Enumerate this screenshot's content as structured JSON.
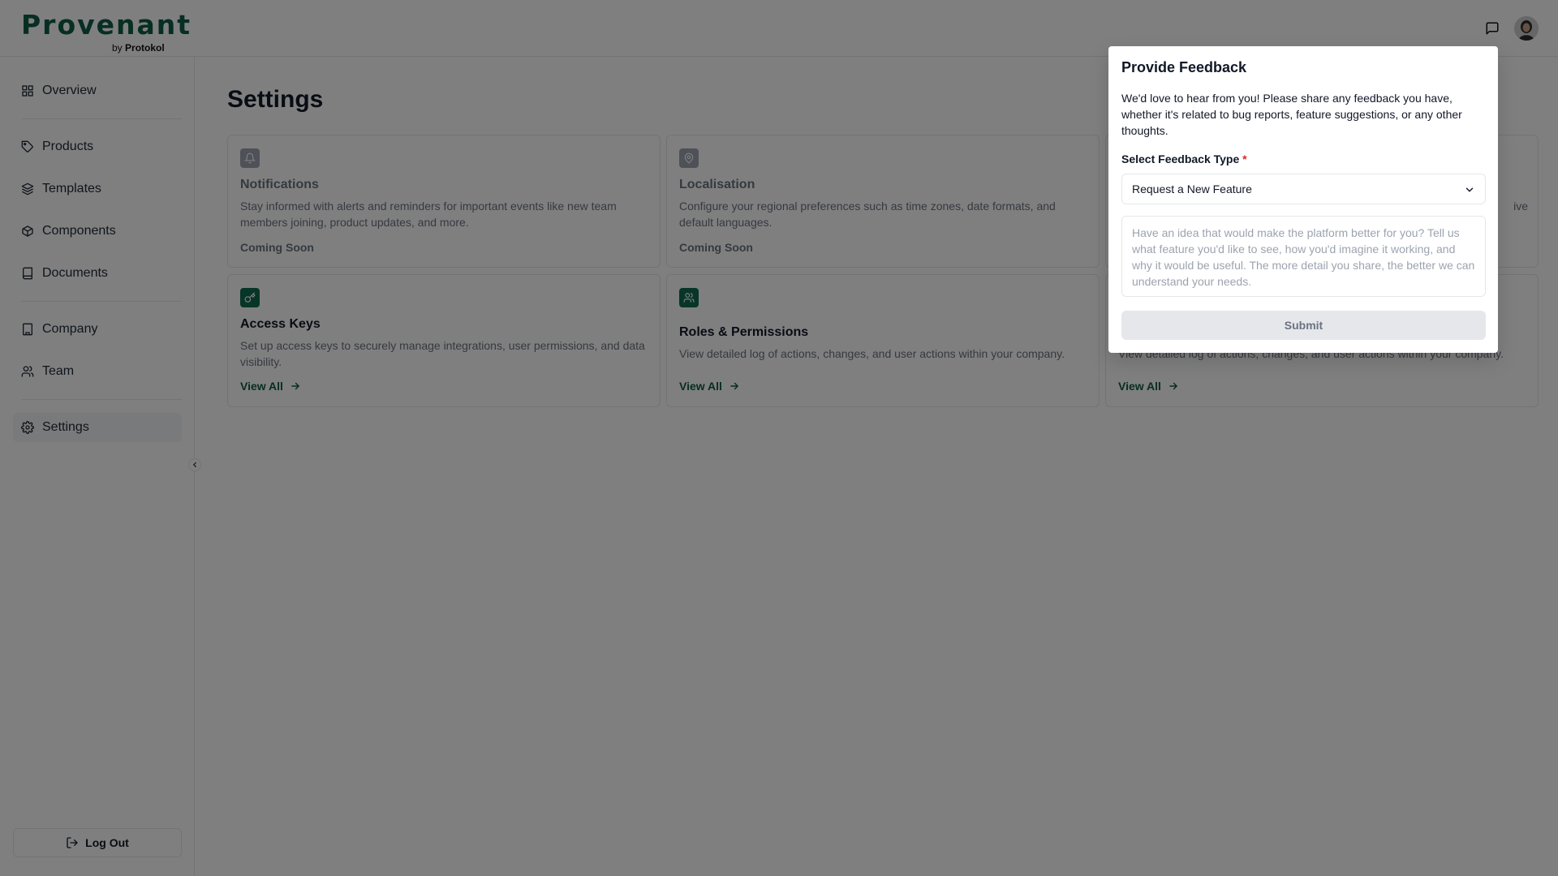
{
  "brand": {
    "name": "Provenant",
    "by": "by",
    "company": "Protokol"
  },
  "header": {
    "chat_icon": "message-square-icon",
    "avatar": "user-avatar"
  },
  "sidebar": {
    "items": [
      {
        "label": "Overview",
        "icon": "grid-icon"
      },
      {
        "label": "Products",
        "icon": "tag-icon"
      },
      {
        "label": "Templates",
        "icon": "layers-icon"
      },
      {
        "label": "Components",
        "icon": "box-icon"
      },
      {
        "label": "Documents",
        "icon": "book-icon"
      },
      {
        "label": "Company",
        "icon": "building-icon"
      },
      {
        "label": "Team",
        "icon": "users-icon"
      },
      {
        "label": "Settings",
        "icon": "gear-icon",
        "active": true
      }
    ],
    "logout_label": "Log Out"
  },
  "main": {
    "title": "Settings",
    "cards": [
      {
        "title": "Notifications",
        "description": "Stay informed with alerts and reminders for important events like new team members joining, product updates, and more.",
        "status": "Coming Soon"
      },
      {
        "title": "Localisation",
        "description": "Configure your regional preferences such as time zones, date formats, and default languages.",
        "status": "Coming Soon"
      },
      {
        "title": "",
        "description": "ive",
        "status": ""
      },
      {
        "title": "Access Keys",
        "description": "Set up access keys to securely manage integrations, user permissions, and data visibility.",
        "link": "View All"
      },
      {
        "title": "Roles & Permissions",
        "description": "View detailed log of actions, changes, and user actions  within your company.",
        "link": "View All"
      },
      {
        "title": "",
        "description": "View detailed log of actions, changes, and user actions within your company.",
        "link": "View All"
      }
    ]
  },
  "modal": {
    "title": "Provide Feedback",
    "text": "We'd love to hear from you! Please share any feedback you have, whether it's related to bug reports, feature suggestions, or any other thoughts.",
    "label": "Select Feedback Type",
    "required_mark": "*",
    "selected": "Request a New Feature",
    "placeholder": "Have an idea that would make the platform better for you? Tell us what feature you'd like to see, how you'd imagine it working, and why it would be useful. The more detail you share, the better we can understand your needs.",
    "submit_label": "Submit"
  }
}
